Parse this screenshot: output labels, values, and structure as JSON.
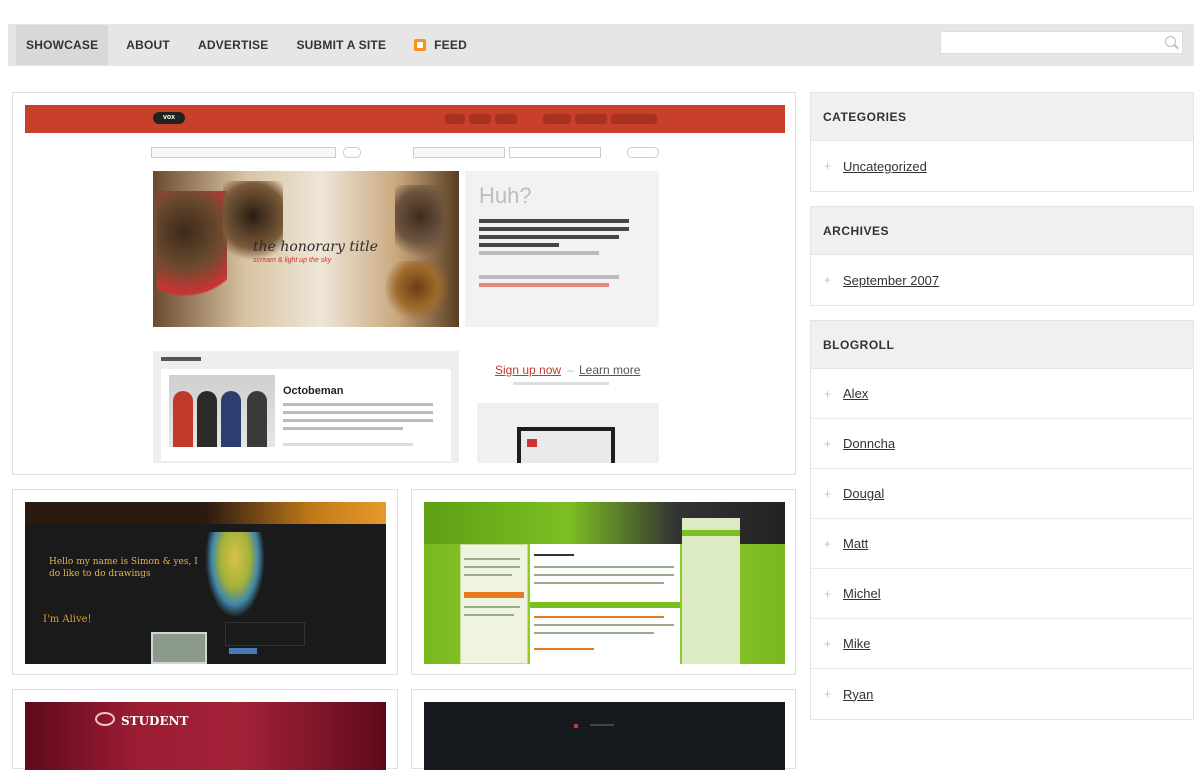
{
  "nav": {
    "items": [
      {
        "label": "SHOWCASE",
        "active": true
      },
      {
        "label": "ABOUT"
      },
      {
        "label": "ADVERTISE"
      },
      {
        "label": "SUBMIT A SITE"
      }
    ],
    "feed_label": "FEED",
    "feed_color": "#f7931e"
  },
  "search": {
    "value": "",
    "placeholder": ""
  },
  "featured": {
    "huh_title": "Huh?",
    "hero_title": "the honorary title",
    "hero_subtitle": "scream & light up the sky",
    "invite_title": "Octobeman",
    "signup_label": "Sign up now",
    "separator": "–",
    "learn_label": "Learn more"
  },
  "tiles": {
    "doodle_text": "Hello my name is Simon & yes, I do like to do drawings",
    "doodle_alive": "I'm Alive!",
    "red_logo": "STUDENT"
  },
  "sidebar": {
    "categories": {
      "title": "CATEGORIES",
      "items": [
        "Uncategorized"
      ]
    },
    "archives": {
      "title": "ARCHIVES",
      "items": [
        "September 2007"
      ]
    },
    "blogroll": {
      "title": "BLOGROLL",
      "items": [
        "Alex",
        "Donncha",
        "Dougal",
        "Matt",
        "Michel",
        "Mike",
        "Ryan"
      ]
    }
  },
  "colors": {
    "vox_red": "#c8402a",
    "signup_red": "#c0392b"
  }
}
